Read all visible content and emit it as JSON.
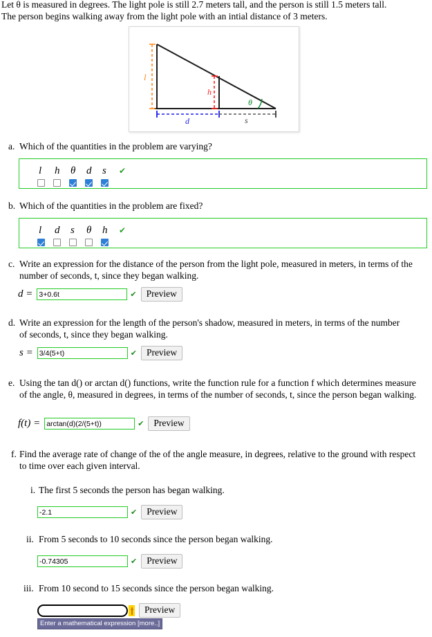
{
  "intro": {
    "line1": "Let θ is measured in degrees. The light pole is still 2.7 meters tall, and the person is still 1.5 meters tall.",
    "line2": "The person begins walking away from the light pole with an intial distance of 3 meters."
  },
  "diagram": {
    "labels": {
      "pole": "l",
      "person": "h",
      "distance": "d",
      "shadow": "s",
      "angle": "θ"
    },
    "colors": {
      "pole": "#ff8a1e",
      "person": "#ff2020",
      "distance": "#1a1aee",
      "shadow": "#555555",
      "angle": "#0a8a2a",
      "triangle": "#1a1a1a"
    }
  },
  "questions": [
    {
      "label": "a.",
      "text": "Which of the quantities in the problem are varying?",
      "type": "choices",
      "options": [
        {
          "symbol": "l",
          "checked": false
        },
        {
          "symbol": "h",
          "checked": false
        },
        {
          "symbol": "θ",
          "checked": true
        },
        {
          "symbol": "d",
          "checked": true
        },
        {
          "symbol": "s",
          "checked": true
        }
      ],
      "correct_mark": "✔"
    },
    {
      "label": "b.",
      "text": "Which of the quantities in the problem are fixed?",
      "type": "choices",
      "options": [
        {
          "symbol": "l",
          "checked": true
        },
        {
          "symbol": "d",
          "checked": false
        },
        {
          "symbol": "s",
          "checked": false
        },
        {
          "symbol": "θ",
          "checked": false
        },
        {
          "symbol": "h",
          "checked": true
        }
      ],
      "correct_mark": "✔"
    },
    {
      "label": "c.",
      "text": "Write an expression for the distance of the person from the light pole, measured in meters, in terms of the number of seconds, t, since they began walking.",
      "type": "answer",
      "lhs": "d =",
      "value": "3+0.6t",
      "placeholder": "",
      "status": "correct",
      "status_mark": "✔",
      "preview_label": "Preview"
    },
    {
      "label": "d.",
      "text": "Write an expression for the length of the person's shadow, measured in meters, in terms of the number of seconds, t, since they began walking.",
      "type": "answer",
      "lhs": "s =",
      "value": "3/4(5+t)",
      "placeholder": "",
      "status": "correct",
      "status_mark": "✔",
      "preview_label": "Preview"
    },
    {
      "label": "e.",
      "text": "Using the tan d() or arctan d() functions, write the function rule for a function f which determines measure of the angle, θ, measured in degrees, in terms of the number of seconds, t, since the person began walking.",
      "type": "answer",
      "lhs": "f(t) =",
      "value": "arctan(d)(2/(5+t))",
      "placeholder": "",
      "status": "correct",
      "status_mark": "✔",
      "preview_label": "Preview"
    },
    {
      "label": "f.",
      "text": "Find the average rate of change of the of the angle measure, in degrees, relative to the ground with respect to time over each given interval.",
      "type": "group",
      "subquestions": [
        {
          "label": "i.",
          "text": "The first 5 seconds the person has began walking.",
          "value": "-2.1",
          "placeholder": "",
          "status": "correct",
          "status_mark": "✔",
          "preview_label": "Preview"
        },
        {
          "label": "ii.",
          "text": "From 5 seconds to 10 seconds since the person began walking.",
          "value": "-0.74305",
          "placeholder": "",
          "status": "correct",
          "status_mark": "✔",
          "preview_label": "Preview"
        },
        {
          "label": "iii.",
          "text": "From 10 second to 15 seconds since the person began walking.",
          "value": "",
          "placeholder": "",
          "status": "focused-empty",
          "status_mark": "",
          "preview_label": "Preview",
          "tooltip": "Enter a mathematical expression [more..]"
        }
      ]
    }
  ]
}
